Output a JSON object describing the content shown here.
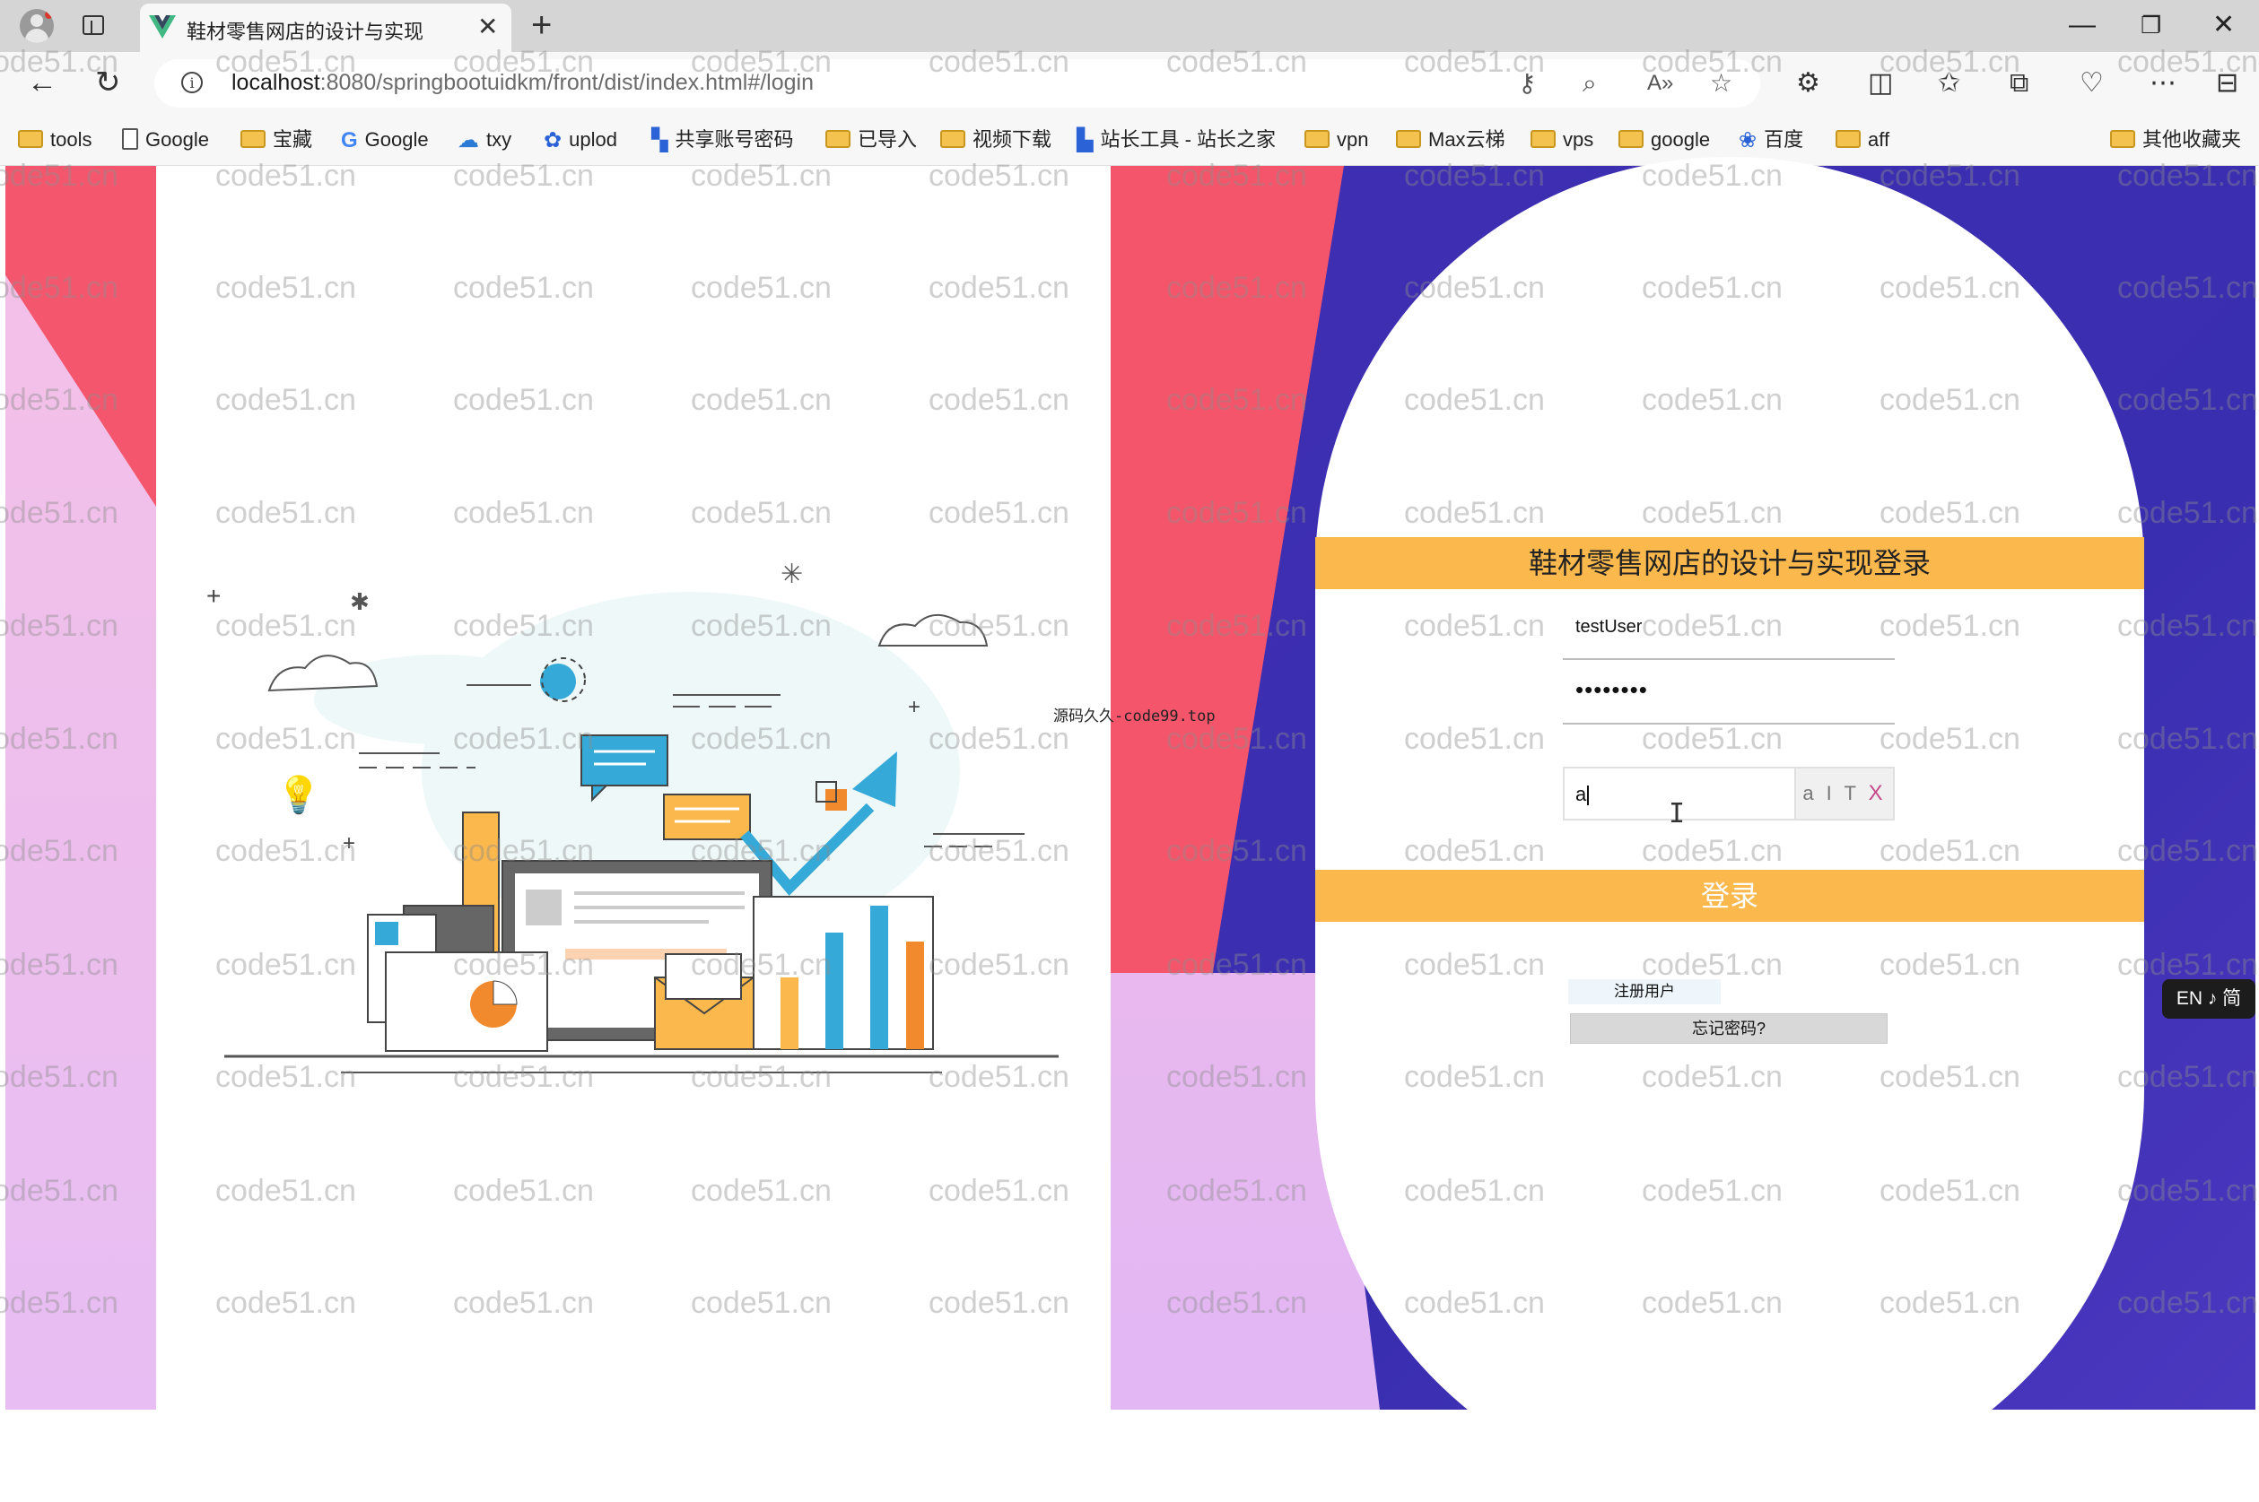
{
  "browser": {
    "tab_title": "鞋材零售网店的设计与实现",
    "url_host": "localhost",
    "url_rest": ":8080/springbootuidkm/front/dist/index.html#/login",
    "bookmarks": [
      "tools",
      "Google",
      "宝藏",
      "Google",
      "txy",
      "uplod",
      "共享账号密码",
      "已导入",
      "视频下载",
      "站长工具 - 站长之家",
      "vpn",
      "Max云梯",
      "vps",
      "google",
      "百度",
      "aff"
    ],
    "other_bookmarks": "其他收藏夹"
  },
  "login": {
    "title": "鞋材零售网店的设计与实现登录",
    "username": "testUser",
    "password_mask": "••••••••",
    "captcha_input": "a",
    "captcha_image_text": "a I T",
    "captcha_image_x": "X",
    "login_button": "登录",
    "register_link": "注册用户",
    "forgot_password": "忘记密码?"
  },
  "overlay": {
    "source_note": "源码久久-code99.top",
    "ime_indicator": "EN ♪ 简",
    "watermark": "code51.cn"
  },
  "colors": {
    "accent_band": "#fbb84c",
    "right_bg": "#3f2fb2",
    "red_shape": "#f4556a",
    "pink_shape": "#e7bdf3"
  }
}
